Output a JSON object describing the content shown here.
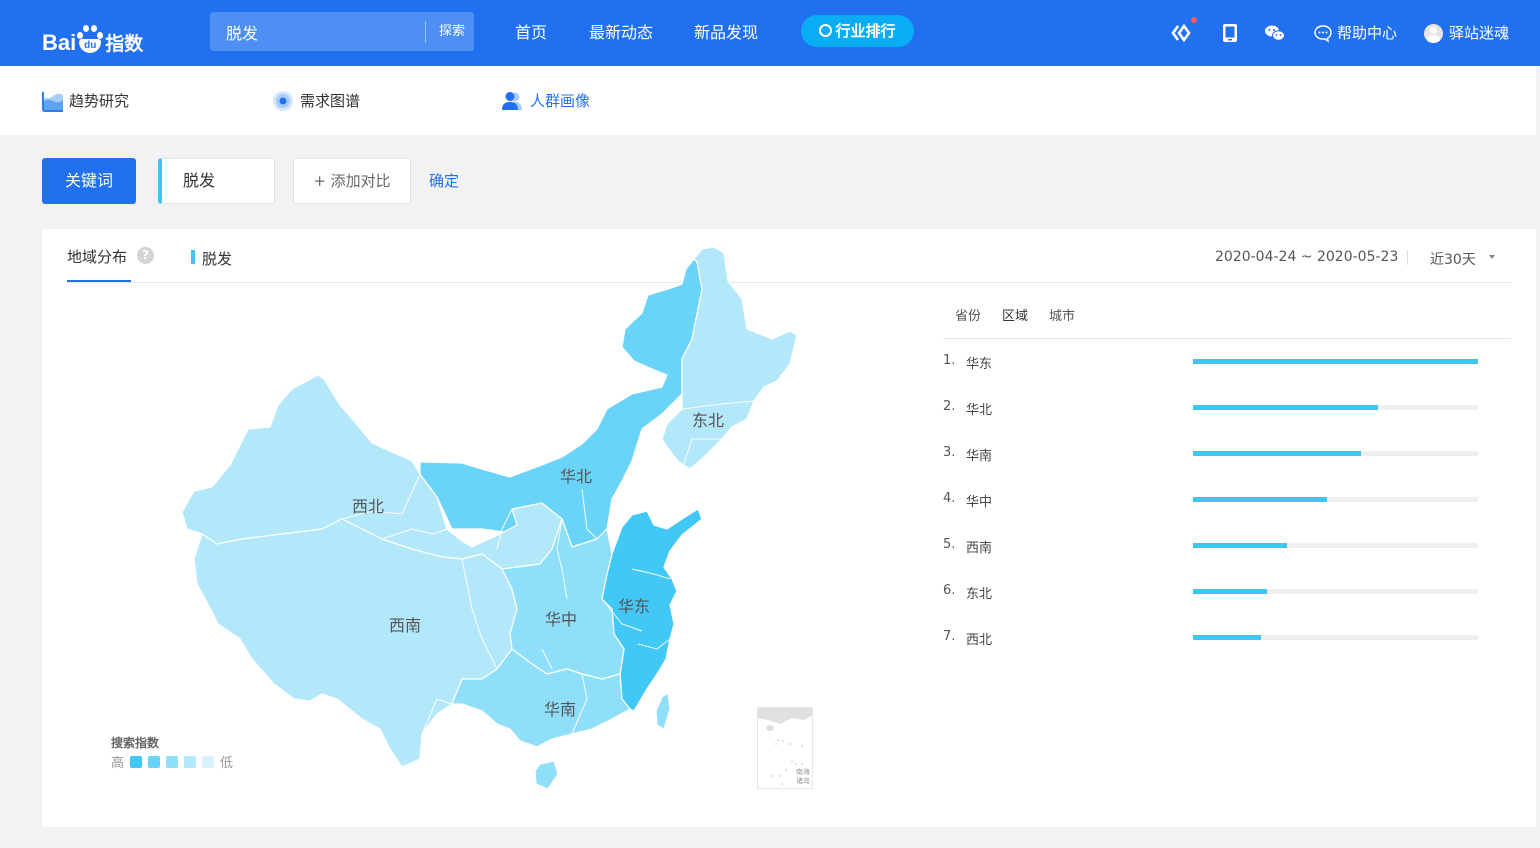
{
  "header": {
    "logo": {
      "bai": "Bai",
      "du": "du",
      "suffix": "指数"
    },
    "search": {
      "value": "脱发",
      "button_label": "探索"
    },
    "nav": [
      {
        "label": "首页"
      },
      {
        "label": "最新动态"
      },
      {
        "label": "新品发现"
      }
    ],
    "rank_button_label": "行业排行",
    "icons": [
      "index-app-icon",
      "mobile-icon",
      "wechat-icon"
    ],
    "help_label": "帮助中心",
    "username": "驿站迷魂",
    "accent_color": "#2170ef"
  },
  "subnav": [
    {
      "label": "趋势研究",
      "icon": "trend-icon"
    },
    {
      "label": "需求图谱",
      "icon": "demand-graph-icon"
    },
    {
      "label": "人群画像",
      "icon": "crowd-portrait-icon",
      "active": true
    }
  ],
  "keyword_bar": {
    "keyword_button": "关键词",
    "keyword_value": "脱发",
    "add_compare": "+ 添加对比",
    "confirm": "确定"
  },
  "panel": {
    "tab_label": "地域分布",
    "help_icon": "?",
    "legend_keyword": "脱发",
    "date_range": "2020-04-24 ~ 2020-05-23",
    "period": "近30天",
    "rank_tabs": [
      "省份",
      "区域",
      "城市"
    ],
    "active_rank_tab": "区域",
    "rankings": [
      {
        "rank": "1.",
        "name": "华东",
        "value": 100
      },
      {
        "rank": "2.",
        "name": "华北",
        "value": 65
      },
      {
        "rank": "3.",
        "name": "华南",
        "value": 59
      },
      {
        "rank": "4.",
        "name": "华中",
        "value": 47
      },
      {
        "rank": "5.",
        "name": "西南",
        "value": 33
      },
      {
        "rank": "6.",
        "name": "东北",
        "value": 26
      },
      {
        "rank": "7.",
        "name": "西北",
        "value": 24
      }
    ],
    "bar_color": "#3ec6f2",
    "map": {
      "region_labels": [
        "西北",
        "华北",
        "东北",
        "西南",
        "华中",
        "华东",
        "华南"
      ],
      "tier_colors": [
        "#41c8f6",
        "#69d3f8",
        "#8fdefa",
        "#b3e8fb",
        "#d8f3fd"
      ],
      "legend_title": "搜索指数",
      "legend_high": "高",
      "legend_low": "低",
      "inset_label_1": "南海",
      "inset_label_2": "诸岛"
    }
  }
}
